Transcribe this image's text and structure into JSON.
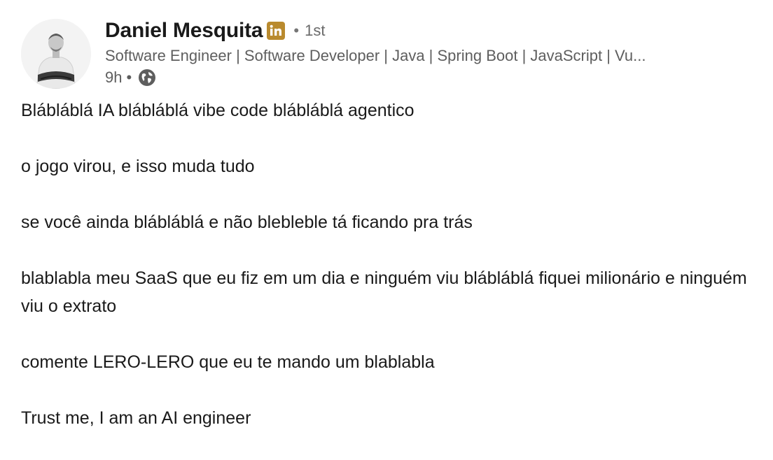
{
  "author": {
    "name": "Daniel Mesquita",
    "badge": "in",
    "separator": "•",
    "degree": "1st",
    "headline": "Software Engineer | Software Developer | Java | Spring Boot | JavaScript | Vu...",
    "time": "9h",
    "time_separator": "•",
    "visibility_icon": "globe-icon"
  },
  "post": {
    "paragraphs": [
      "Blábláblá IA blábláblá vibe code blábláblá agentico",
      "o jogo virou, e isso muda tudo",
      "se você ainda blábláblá e não blebleble tá ficando pra trás",
      "blablabla meu SaaS que eu fiz em um dia e ninguém viu blábláblá fiquei milionário e ninguém viu o extrato",
      "comente LERO-LERO que eu te mando um blablabla",
      "Trust me, I am an AI engineer"
    ]
  },
  "colors": {
    "linkedin_badge": "#b98a2e",
    "text_primary": "#1a1a1a",
    "text_secondary": "#5e5e5e"
  }
}
